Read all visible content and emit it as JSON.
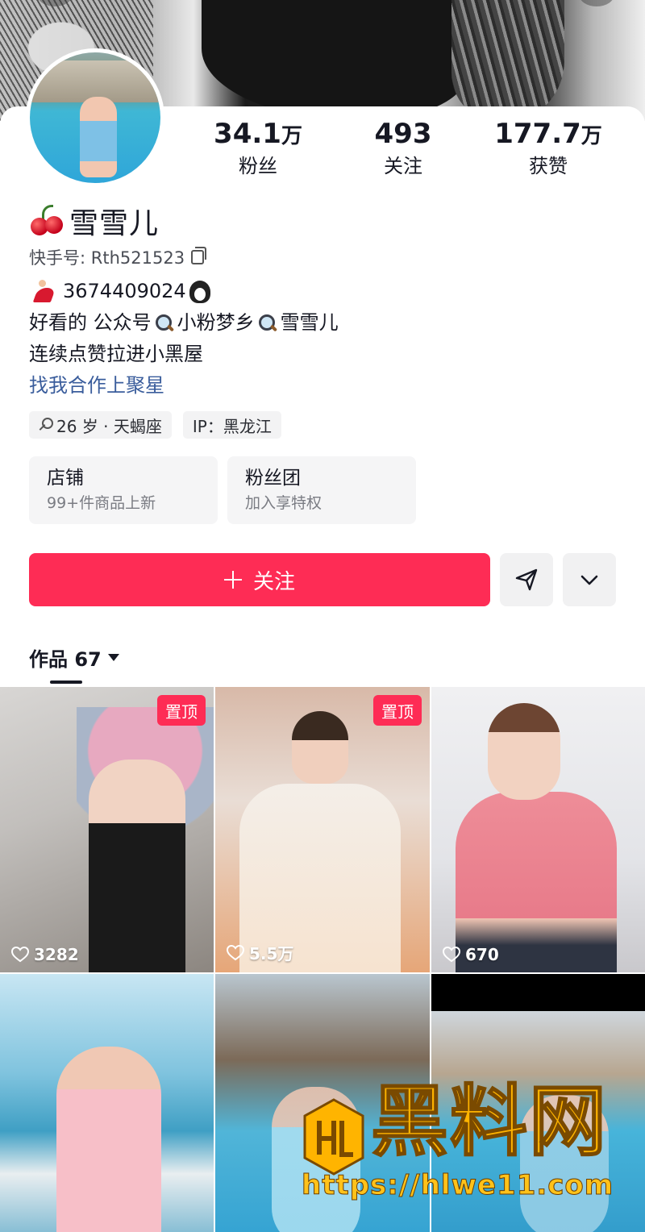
{
  "profile": {
    "name": "雪雪儿",
    "kuai_id": "快手号: Rth521523",
    "stats": [
      {
        "value": "34.1",
        "unit": "万",
        "label": "粉丝"
      },
      {
        "value": "493",
        "unit": "",
        "label": "关注"
      },
      {
        "value": "177.7",
        "unit": "万",
        "label": "获赞"
      }
    ],
    "bio": {
      "line1": "3674409024",
      "line2_a": "好看的 公众号",
      "line2_b": " 小粉梦乡 ",
      "line2_c": "雪雪儿",
      "line3": "连续点赞拉进小黑屋",
      "link": "找我合作上聚星"
    },
    "tags": [
      "26 岁 · 天蝎座",
      "IP：黑龙江"
    ]
  },
  "feature_cards": [
    {
      "title": "店铺",
      "subtitle": "99+件商品上新"
    },
    {
      "title": "粉丝团",
      "subtitle": "加入享特权"
    }
  ],
  "actions": {
    "follow_label": "关注"
  },
  "tabs": {
    "works_label": "作品 67"
  },
  "videos": [
    {
      "pinned_label": "置顶",
      "likes": "3282"
    },
    {
      "pinned_label": "置顶",
      "likes": "5.5万"
    },
    {
      "pinned_label": "",
      "likes": "670"
    },
    {
      "pinned_label": "",
      "likes": ""
    },
    {
      "pinned_label": "",
      "likes": ""
    },
    {
      "pinned_label": "",
      "likes": ""
    }
  ],
  "watermark": {
    "title": "黑料网",
    "url": "https://hlwe11.com"
  },
  "colors": {
    "accent": "#fe2c55",
    "link": "#3a5d9c",
    "watermark": "#ffb400"
  }
}
